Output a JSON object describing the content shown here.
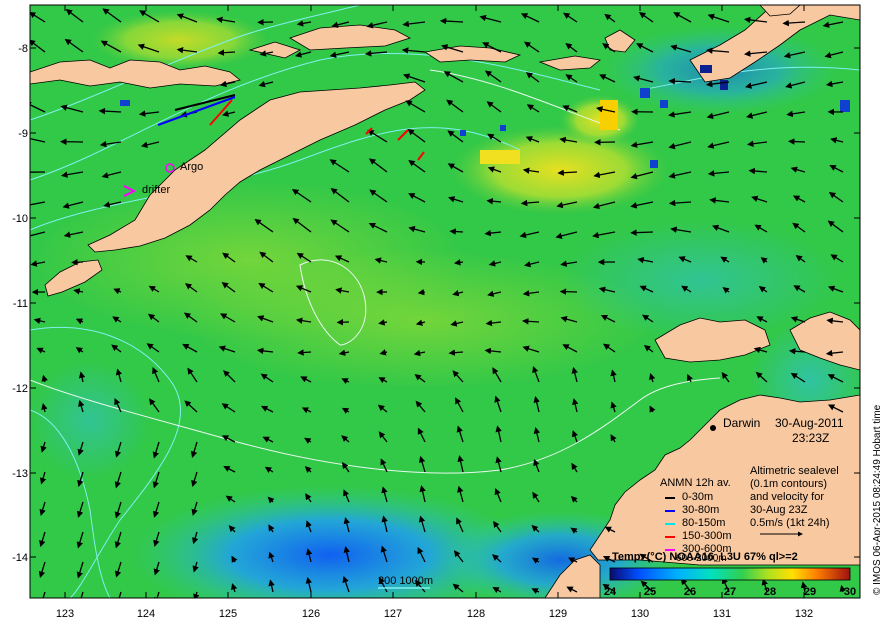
{
  "map": {
    "lat_ticks": [
      "-8",
      "-9",
      "-10",
      "-11",
      "-12",
      "-13",
      "-14"
    ],
    "lon_ticks": [
      "123",
      "124",
      "125",
      "126",
      "127",
      "128",
      "129",
      "130",
      "131",
      "132"
    ],
    "lat_range": [
      -14.5,
      -7.6
    ],
    "lon_range": [
      122.6,
      132.65
    ]
  },
  "labels": {
    "argo": "Argo",
    "drifter": "drifter",
    "darwin": "Darwin",
    "date": "30-Aug-2011",
    "time": "23:23Z",
    "depth_scale": "200 1000m",
    "credit": "© IMOS 06-Apr-2015 08:24:49 Hobart time"
  },
  "altimetry_note": {
    "line1": "Altimetric sealevel",
    "line2": "(0.1m contours)",
    "line3": "and velocity for",
    "line4": "30-Aug 23Z",
    "line5": "0.5m/s (1kt 24h)"
  },
  "anmn_legend": {
    "title": "ANMN 12h av.",
    "items": [
      {
        "label": "0-30m",
        "color": "#000000"
      },
      {
        "label": "30-80m",
        "color": "#0000ff"
      },
      {
        "label": "80-150m",
        "color": "#00e5ee"
      },
      {
        "label": "150-300m",
        "color": "#ff0000"
      },
      {
        "label": "300-600m",
        "color": "#ff00ff"
      }
    ],
    "overflow_text": "600-2000m"
  },
  "colorbar": {
    "title": "Temp. (°C) NOAA16_L3U 67% ql>=2",
    "ticks": [
      "24",
      "25",
      "26",
      "27",
      "28",
      "29",
      "30"
    ],
    "range": [
      24,
      30
    ]
  },
  "colors": {
    "land": "#f8c8a0",
    "ocean_base": "#2ecc48",
    "contour": "#80f0f0",
    "arrow": "#000000"
  }
}
